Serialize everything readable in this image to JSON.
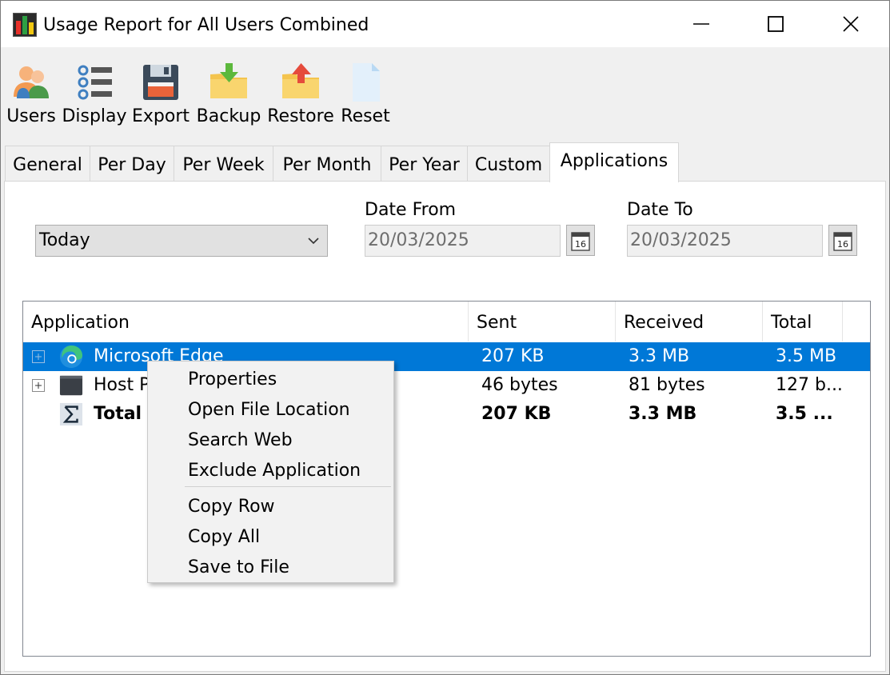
{
  "window": {
    "title": "Usage Report for All Users Combined",
    "controls": {
      "minimize": "minimize",
      "maximize": "maximize",
      "close": "close"
    }
  },
  "toolbar": {
    "items": [
      {
        "label": "Users",
        "icon": "users-icon"
      },
      {
        "label": "Display",
        "icon": "display-list-icon"
      },
      {
        "label": "Export",
        "icon": "floppy-disk-icon"
      },
      {
        "label": "Backup",
        "icon": "folder-down-arrow-icon"
      },
      {
        "label": "Restore",
        "icon": "folder-up-arrow-icon"
      },
      {
        "label": "Reset",
        "icon": "blank-document-icon"
      }
    ]
  },
  "tabs": [
    {
      "label": "General",
      "active": false
    },
    {
      "label": "Per Day",
      "active": false
    },
    {
      "label": "Per Week",
      "active": false
    },
    {
      "label": "Per Month",
      "active": false
    },
    {
      "label": "Per Year",
      "active": false
    },
    {
      "label": "Custom",
      "active": false
    },
    {
      "label": "Applications",
      "active": true
    }
  ],
  "filters": {
    "period": "Today",
    "date_from_label": "Date From",
    "date_from_value": "20/03/2025",
    "date_to_label": "Date To",
    "date_to_value": "20/03/2025",
    "calendar_day": "16"
  },
  "table": {
    "columns": [
      "Application",
      "Sent",
      "Received",
      "Total"
    ],
    "rows": [
      {
        "application": "Microsoft Edge",
        "sent": "207 KB",
        "received": "3.3 MB",
        "total": "3.5 MB",
        "selected": true,
        "icon": "edge-browser-icon"
      },
      {
        "application": "Host P",
        "sent": "46 bytes",
        "received": "81 bytes",
        "total": "127 b...",
        "selected": false,
        "icon": "host-process-icon"
      },
      {
        "application": "Total",
        "sent": "207 KB",
        "received": "3.3 MB",
        "total": "3.5 ...",
        "selected": false,
        "icon": "sigma-icon"
      }
    ]
  },
  "context_menu": {
    "items": [
      "Properties",
      "Open File Location",
      "Search Web",
      "Exclude Application",
      "Copy Row",
      "Copy All",
      "Save to File"
    ]
  },
  "colors": {
    "selection": "#0078d7",
    "window_bg": "#f0f0f0",
    "panel_bg": "#ffffff"
  }
}
